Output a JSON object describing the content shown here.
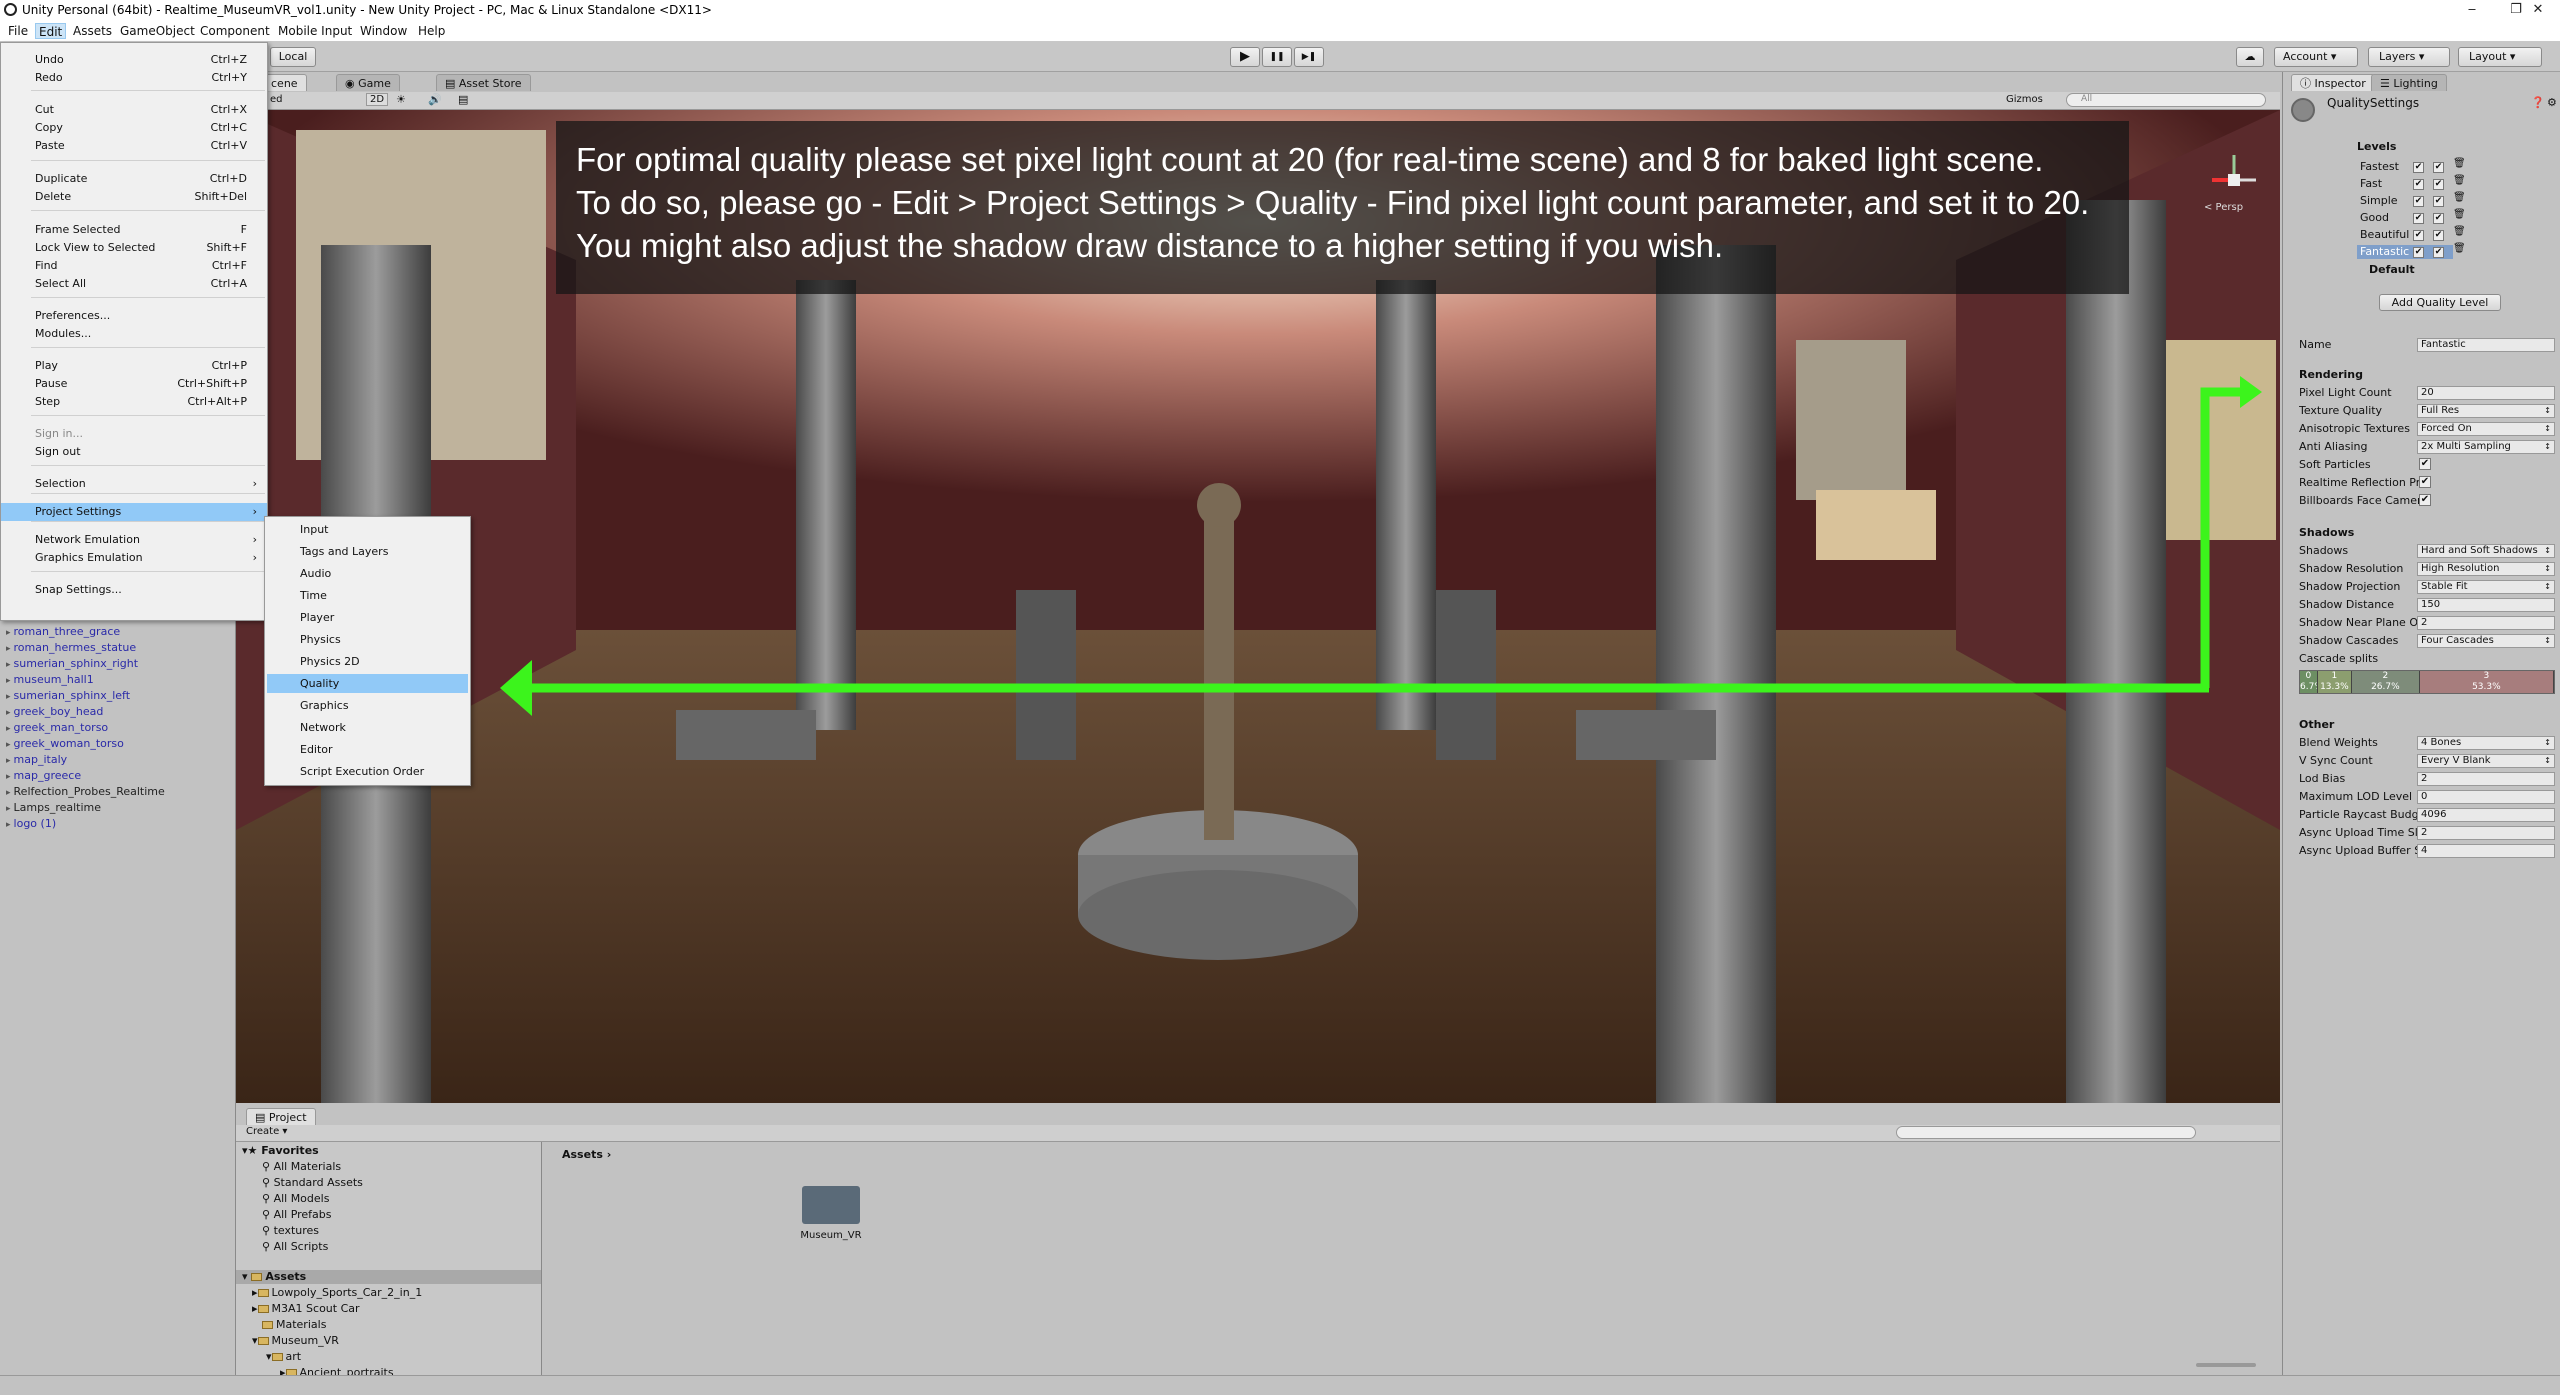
{
  "window": {
    "title": "Unity Personal (64bit) - Realtime_MuseumVR_vol1.unity - New Unity Project - PC, Mac & Linux Standalone <DX11>",
    "controls": [
      "‒",
      "❐",
      "✕"
    ]
  },
  "menubar": [
    "File",
    "Edit",
    "Assets",
    "GameObject",
    "Component",
    "Mobile Input",
    "Window",
    "Help"
  ],
  "toolbar": {
    "local_label": "Local",
    "account_label": "Account",
    "layers_label": "Layers",
    "layout_label": "Layout",
    "play_icons": [
      "▶",
      "❚❚",
      "▶❚"
    ]
  },
  "scene_tabs": [
    "cene",
    "Game",
    "Asset Store"
  ],
  "scene_toolbar": {
    "shaded": "ed",
    "mode_2d": "2D",
    "gizmos": "Gizmos",
    "search_placeholder": "All",
    "persp": "< Persp"
  },
  "overlay": {
    "line1": "For optimal quality please set pixel light count at 20 (for real-time scene) and 8 for baked light scene.",
    "line2": "To do so, please go - Edit > Project Settings > Quality  - Find pixel light count parameter, and set it to 20.",
    "line3": "You might also adjust the shadow draw distance to a higher setting if you wish."
  },
  "edit_menu": [
    {
      "label": "Undo",
      "shortcut": "Ctrl+Z"
    },
    {
      "label": "Redo",
      "shortcut": "Ctrl+Y"
    },
    {
      "label": "Cut",
      "shortcut": "Ctrl+X"
    },
    {
      "label": "Copy",
      "shortcut": "Ctrl+C"
    },
    {
      "label": "Paste",
      "shortcut": "Ctrl+V"
    },
    {
      "label": "Duplicate",
      "shortcut": "Ctrl+D"
    },
    {
      "label": "Delete",
      "shortcut": "Shift+Del"
    },
    {
      "label": "Frame Selected",
      "shortcut": "F"
    },
    {
      "label": "Lock View to Selected",
      "shortcut": "Shift+F"
    },
    {
      "label": "Find",
      "shortcut": "Ctrl+F"
    },
    {
      "label": "Select All",
      "shortcut": "Ctrl+A"
    },
    {
      "label": "Preferences...",
      "shortcut": ""
    },
    {
      "label": "Modules...",
      "shortcut": ""
    },
    {
      "label": "Play",
      "shortcut": "Ctrl+P"
    },
    {
      "label": "Pause",
      "shortcut": "Ctrl+Shift+P"
    },
    {
      "label": "Step",
      "shortcut": "Ctrl+Alt+P"
    },
    {
      "label": "Sign in...",
      "shortcut": ""
    },
    {
      "label": "Sign out",
      "shortcut": ""
    },
    {
      "label": "Selection",
      "shortcut": ""
    },
    {
      "label": "Project Settings",
      "shortcut": ""
    },
    {
      "label": "Network Emulation",
      "shortcut": ""
    },
    {
      "label": "Graphics Emulation",
      "shortcut": ""
    },
    {
      "label": "Snap Settings...",
      "shortcut": ""
    }
  ],
  "project_settings_submenu": [
    "Input",
    "Tags and Layers",
    "Audio",
    "Time",
    "Player",
    "Physics",
    "Physics 2D",
    "Quality",
    "Graphics",
    "Network",
    "Editor",
    "Script Execution Order"
  ],
  "hierarchy": [
    "roman_three_grace",
    "roman_hermes_statue",
    "sumerian_sphinx_right",
    "museum_hall1",
    "sumerian_sphinx_left",
    "greek_boy_head",
    "greek_man_torso",
    "greek_woman_torso",
    "map_italy",
    "map_greece",
    "Relfection_Probes_Realtime",
    "Lamps_realtime",
    "logo (1)"
  ],
  "inspector": {
    "tabs": [
      "Inspector",
      "Lighting"
    ],
    "component": "QualitySettings",
    "levels_title": "Levels",
    "levels": [
      "Fastest",
      "Fast",
      "Simple",
      "Good",
      "Beautiful",
      "Fantastic"
    ],
    "default_label": "Default",
    "add_level_button": "Add Quality Level",
    "name_label": "Name",
    "name_value": "Fantastic",
    "rendering_title": "Rendering",
    "rendering": [
      {
        "label": "Pixel Light Count",
        "value": "20"
      },
      {
        "label": "Texture Quality",
        "value": "Full Res"
      },
      {
        "label": "Anisotropic Textures",
        "value": "Forced On"
      },
      {
        "label": "Anti Aliasing",
        "value": "2x Multi Sampling"
      },
      {
        "label": "Soft Particles",
        "value": "✔"
      },
      {
        "label": "Realtime Reflection Probes",
        "value": "✔"
      },
      {
        "label": "Billboards Face Camera Position",
        "value": "✔"
      }
    ],
    "shadows_title": "Shadows",
    "shadows": [
      {
        "label": "Shadows",
        "value": "Hard and Soft Shadows"
      },
      {
        "label": "Shadow Resolution",
        "value": "High Resolution"
      },
      {
        "label": "Shadow Projection",
        "value": "Stable Fit"
      },
      {
        "label": "Shadow Distance",
        "value": "150"
      },
      {
        "label": "Shadow Near Plane Offset",
        "value": "2"
      },
      {
        "label": "Shadow Cascades",
        "value": "Four Cascades"
      },
      {
        "label": "Cascade splits",
        "value": ""
      }
    ],
    "cascades": [
      {
        "index": "0",
        "pct": "6.7%",
        "share": 0.067,
        "color": "#6d8f63"
      },
      {
        "index": "1",
        "pct": "13.3%",
        "share": 0.133,
        "color": "#8c9e6f"
      },
      {
        "index": "2",
        "pct": "26.7%",
        "share": 0.267,
        "color": "#7e8c7a"
      },
      {
        "index": "3",
        "pct": "53.3%",
        "share": 0.533,
        "color": "#a77d7d"
      }
    ],
    "other_title": "Other",
    "other": [
      {
        "label": "Blend Weights",
        "value": "4 Bones"
      },
      {
        "label": "V Sync Count",
        "value": "Every V Blank"
      },
      {
        "label": "Lod Bias",
        "value": "2"
      },
      {
        "label": "Maximum LOD Level",
        "value": "0"
      },
      {
        "label": "Particle Raycast Budget",
        "value": "4096"
      },
      {
        "label": "Async Upload Time Slice",
        "value": "2"
      },
      {
        "label": "Async Upload Buffer Size",
        "value": "4"
      }
    ]
  },
  "project": {
    "tab": "Project",
    "create": "Create",
    "favorites_title": "Favorites",
    "favorites": [
      "All Materials",
      "Standard Assets",
      "All Models",
      "All Prefabs",
      "textures",
      "All Scripts"
    ],
    "assets_title": "Assets",
    "assets_tree": [
      "Lowpoly_Sports_Car_2_in_1",
      "M3A1 Scout Car",
      "Materials",
      "Museum_VR",
      "art",
      "Ancient_portraits"
    ],
    "breadcrumb": "Assets ›",
    "folder_item": "Museum_VR"
  },
  "colors": {
    "accent_green": "#3cf41c",
    "highlight": "#91c9f7"
  }
}
